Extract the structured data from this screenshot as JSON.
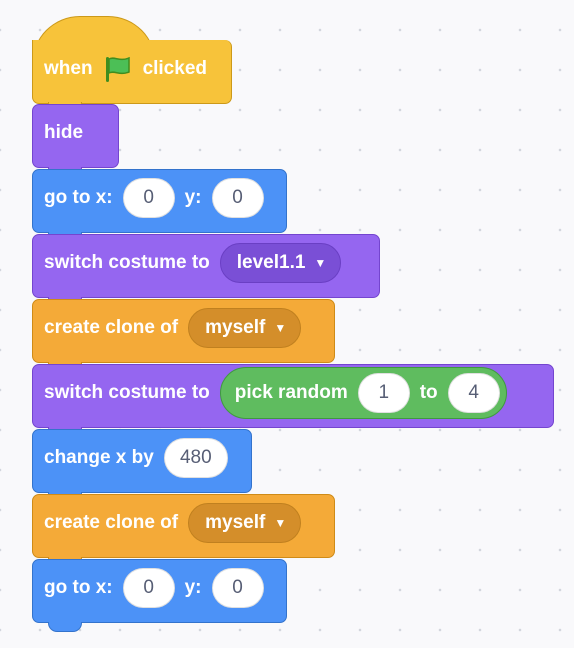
{
  "script": {
    "hat": {
      "label_when": "when",
      "flag_icon": "green-flag-icon",
      "label_clicked": "clicked"
    },
    "hide": {
      "label": "hide"
    },
    "goto1": {
      "label_x": "go to x:",
      "x": "0",
      "label_y": "y:",
      "y": "0"
    },
    "costume1": {
      "label": "switch costume to",
      "value": "level1.1"
    },
    "clone1": {
      "label": "create clone of",
      "value": "myself"
    },
    "costume2": {
      "label": "switch costume to",
      "reporter_label": "pick random",
      "from": "1",
      "label_to": "to",
      "to": "4"
    },
    "changex": {
      "label": "change x by",
      "value": "480"
    },
    "clone2": {
      "label": "create clone of",
      "value": "myself"
    },
    "goto2": {
      "label_x": "go to x:",
      "x": "0",
      "label_y": "y:",
      "y": "0"
    }
  },
  "colors": {
    "events": "#f7c33a",
    "looks": "#9566f0",
    "motion": "#4c92f7",
    "control": "#f4aa38",
    "operators": "#5fbc5f",
    "workspace": "#f9f9fb"
  }
}
